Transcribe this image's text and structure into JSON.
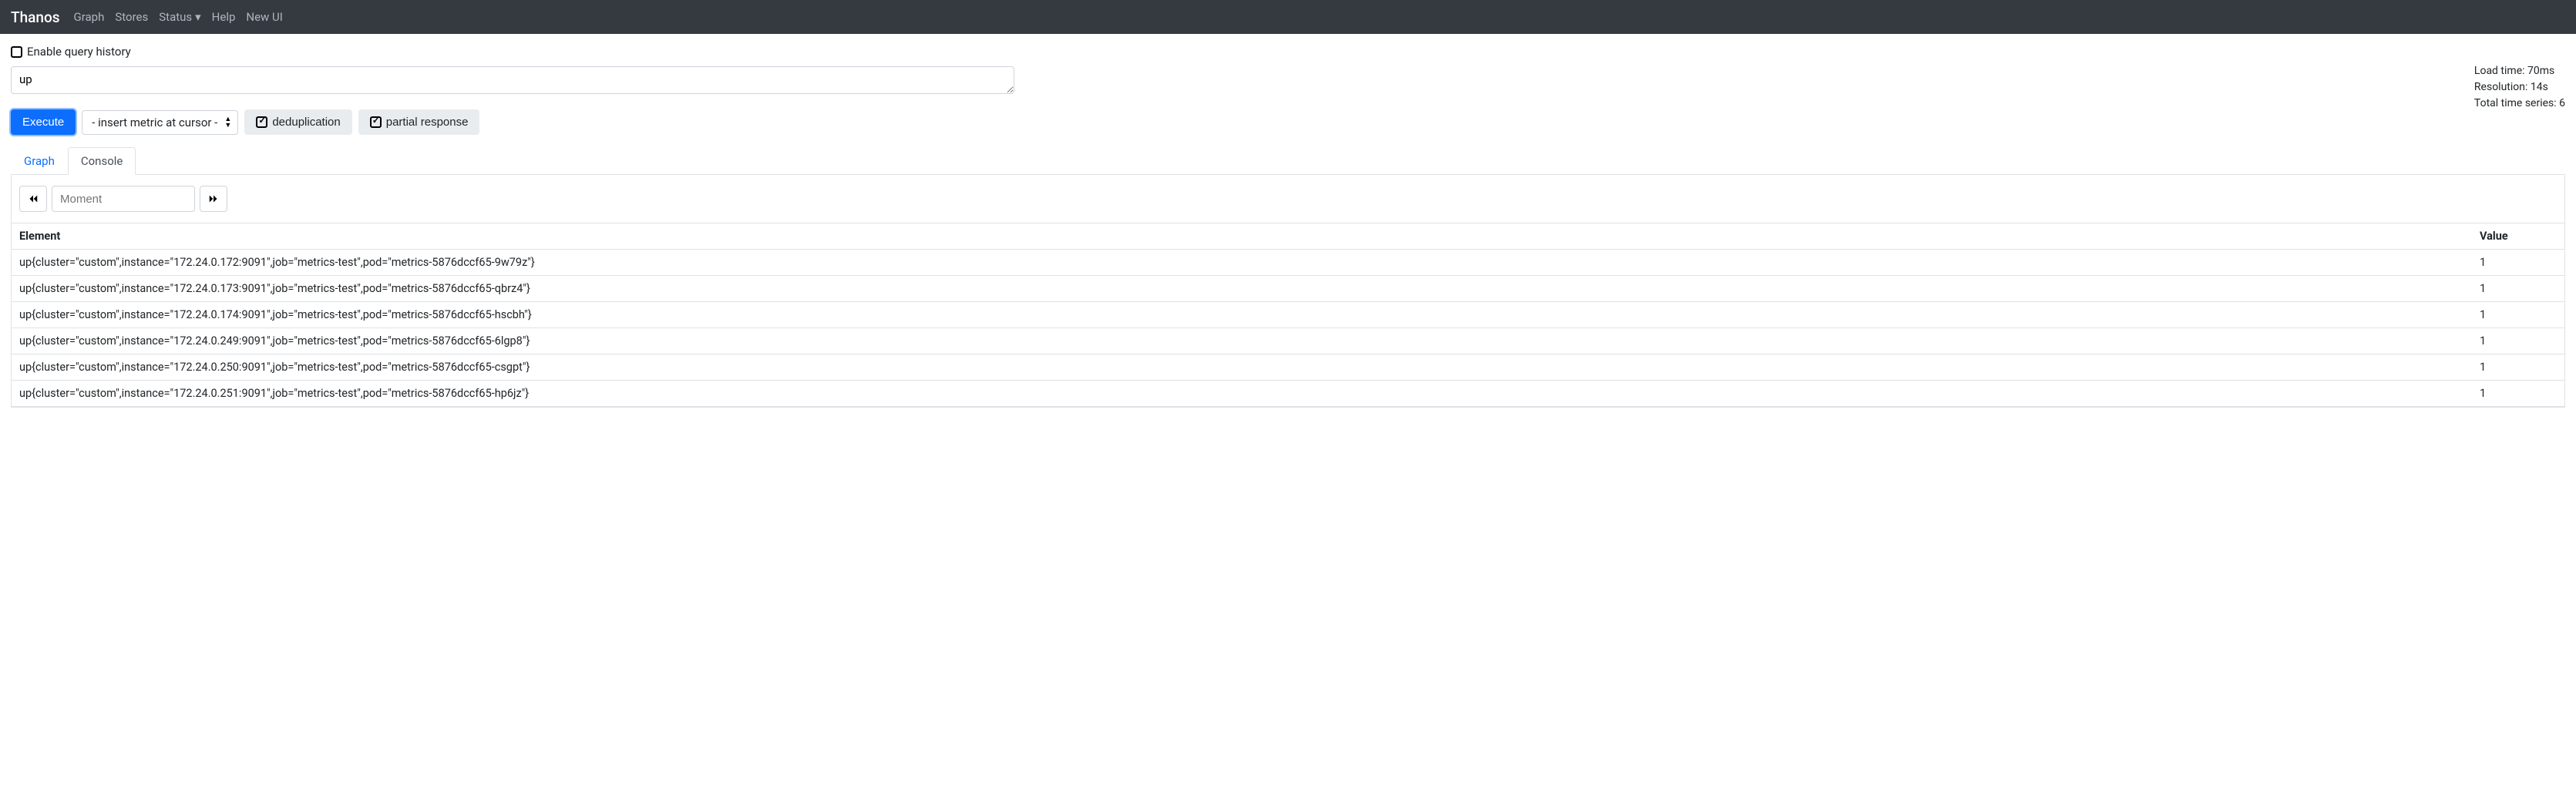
{
  "nav": {
    "brand": "Thanos",
    "items": [
      "Graph",
      "Stores",
      "Status",
      "Help",
      "New UI"
    ],
    "dropdown_index": 2
  },
  "history_checkbox_label": "Enable query history",
  "expression_value": "up",
  "stats": {
    "load_time": "Load time: 70ms",
    "resolution": "Resolution: 14s",
    "total_series": "Total time series: 6"
  },
  "controls": {
    "execute_label": "Execute",
    "metric_select_label": "- insert metric at cursor -",
    "dedup_label": "deduplication",
    "partial_label": "partial response"
  },
  "tabs": {
    "graph": "Graph",
    "console": "Console"
  },
  "moment_placeholder": "Moment",
  "table": {
    "headers": {
      "element": "Element",
      "value": "Value"
    },
    "rows": [
      {
        "element": "up{cluster=\"custom\",instance=\"172.24.0.172:9091\",job=\"metrics-test\",pod=\"metrics-5876dccf65-9w79z\"}",
        "value": "1"
      },
      {
        "element": "up{cluster=\"custom\",instance=\"172.24.0.173:9091\",job=\"metrics-test\",pod=\"metrics-5876dccf65-qbrz4\"}",
        "value": "1"
      },
      {
        "element": "up{cluster=\"custom\",instance=\"172.24.0.174:9091\",job=\"metrics-test\",pod=\"metrics-5876dccf65-hscbh\"}",
        "value": "1"
      },
      {
        "element": "up{cluster=\"custom\",instance=\"172.24.0.249:9091\",job=\"metrics-test\",pod=\"metrics-5876dccf65-6lgp8\"}",
        "value": "1"
      },
      {
        "element": "up{cluster=\"custom\",instance=\"172.24.0.250:9091\",job=\"metrics-test\",pod=\"metrics-5876dccf65-csgpt\"}",
        "value": "1"
      },
      {
        "element": "up{cluster=\"custom\",instance=\"172.24.0.251:9091\",job=\"metrics-test\",pod=\"metrics-5876dccf65-hp6jz\"}",
        "value": "1"
      }
    ]
  }
}
